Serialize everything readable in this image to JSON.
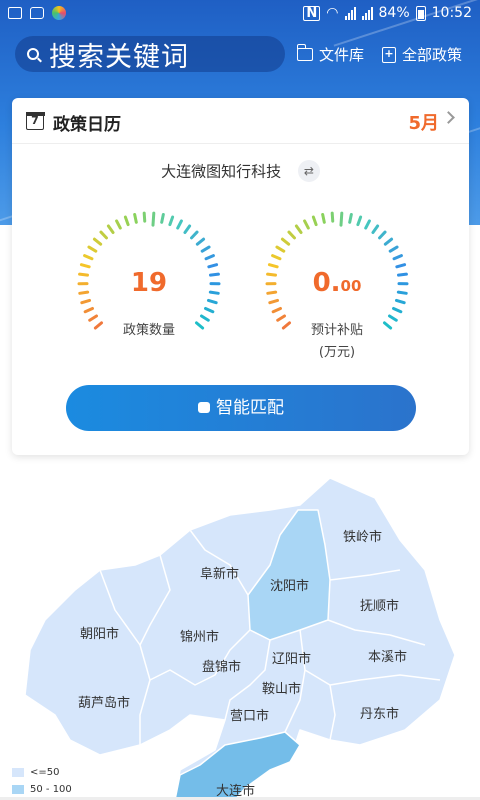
{
  "status_bar": {
    "battery": "84%",
    "time": "10:52"
  },
  "search": {
    "placeholder": "搜索关键词"
  },
  "links": {
    "file_library": "文件库",
    "all_policies": "全部政策"
  },
  "calendar": {
    "title": "政策日历",
    "icon_day": "7",
    "month": "5月",
    "company": "大连微图知行科技",
    "gauges": [
      {
        "value": "19",
        "decimal": "",
        "label": "政策数量",
        "sublabel": ""
      },
      {
        "value": "0.",
        "decimal": "00",
        "label": "预计补贴",
        "sublabel": "(万元)"
      }
    ],
    "match_button": "智能匹配"
  },
  "map": {
    "cities": {
      "tieling": "铁岭市",
      "fuxin": "阜新市",
      "shenyang": "沈阳市",
      "fushun": "抚顺市",
      "chaoyang": "朝阳市",
      "jinzhou": "锦州市",
      "liaoyang": "辽阳市",
      "benxi": "本溪市",
      "panjin": "盘锦市",
      "anshan": "鞍山市",
      "huludao": "葫芦岛市",
      "yingkou": "营口市",
      "dandong": "丹东市",
      "dalian": "大连市"
    },
    "legend": [
      {
        "label": "<=50",
        "color": "#d6e6fb"
      },
      {
        "label": "50 - 100",
        "color": "#a9d6f5"
      }
    ],
    "colors": {
      "low": "#d6e6fb",
      "mid": "#a9d6f5",
      "high": "#74bde9"
    }
  }
}
